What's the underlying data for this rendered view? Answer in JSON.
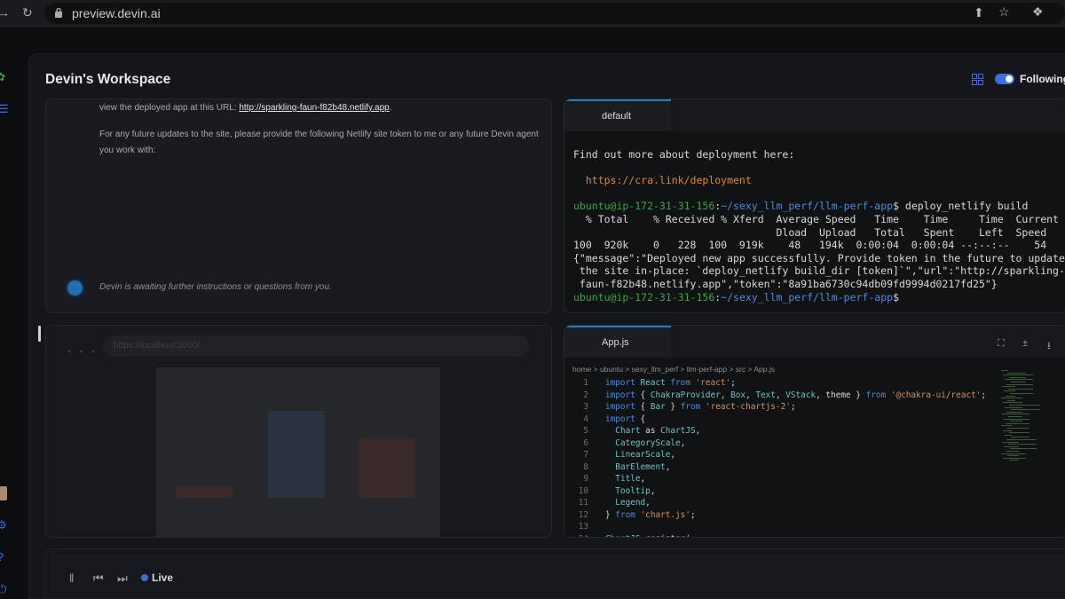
{
  "browser": {
    "url": "preview.devin.ai"
  },
  "workspace": {
    "title": "Devin's Workspace",
    "following_label": "Following"
  },
  "chat": {
    "line1_prefix": "view the deployed app at this URL: ",
    "line1_link": "http://sparkling-faun-f82b48.netlify.app",
    "line1_suffix": ".",
    "line2": "For any future updates to the site, please provide the following Netlify site token to me or any future Devin agent you work with:",
    "awaiting": "Devin is awaiting further instructions or questions from you."
  },
  "preview": {
    "url": "https://localhost:3000/"
  },
  "terminal": {
    "tab": "default",
    "lines": [
      {
        "type": "plain",
        "text": "Find out more about deployment here:"
      },
      {
        "type": "blank",
        "text": ""
      },
      {
        "type": "link",
        "text": "  https://cra.link/deployment"
      },
      {
        "type": "blank",
        "text": ""
      },
      {
        "type": "prompt",
        "user": "ubuntu@ip-172-31-31-156",
        "path": "~/sexy_llm_perf/llm-perf-app",
        "cmd": "$ deploy_netlify build"
      },
      {
        "type": "plain",
        "text": "  % Total    % Received % Xferd  Average Speed   Time    Time     Time  Current"
      },
      {
        "type": "plain",
        "text": "                                 Dload  Upload   Total   Spent    Left  Speed"
      },
      {
        "type": "plain",
        "text": "100  920k    0   228  100  919k    48   194k  0:00:04  0:00:04 --:--:--    54"
      },
      {
        "type": "plain",
        "text": "{\"message\":\"Deployed new app successfully. Provide token in the future to update"
      },
      {
        "type": "plain",
        "text": " the site in-place: `deploy_netlify build_dir [token]`\",\"url\":\"http://sparkling-"
      },
      {
        "type": "plain",
        "text": " faun-f82b48.netlify.app\",\"token\":\"8a91ba6730c94db09fd9994d0217fd25\"}"
      },
      {
        "type": "prompt",
        "user": "ubuntu@ip-172-31-31-156",
        "path": "~/sexy_llm_perf/llm-perf-app",
        "cmd": "$ "
      }
    ]
  },
  "editor": {
    "tab": "App.js",
    "breadcrumb": "home > ubuntu > sexy_llm_perf > llm-perf-app > src > App.js",
    "lines": [
      {
        "n": "1",
        "tokens": [
          [
            "kw",
            "import "
          ],
          [
            "id",
            "React "
          ],
          [
            "kw",
            "from "
          ],
          [
            "st",
            "'react'"
          ],
          [
            "pl",
            ";"
          ]
        ]
      },
      {
        "n": "2",
        "tokens": [
          [
            "kw",
            "import "
          ],
          [
            "pl",
            "{ "
          ],
          [
            "id",
            "ChakraProvider"
          ],
          [
            "pl",
            ", "
          ],
          [
            "id",
            "Box"
          ],
          [
            "pl",
            ", "
          ],
          [
            "id",
            "Text"
          ],
          [
            "pl",
            ", "
          ],
          [
            "id",
            "VStack"
          ],
          [
            "pl",
            ", theme } "
          ],
          [
            "kw",
            "from "
          ],
          [
            "st",
            "'@chakra-ui/react'"
          ],
          [
            "pl",
            ";"
          ]
        ]
      },
      {
        "n": "3",
        "tokens": [
          [
            "kw",
            "import "
          ],
          [
            "pl",
            "{ "
          ],
          [
            "id",
            "Bar "
          ],
          [
            "pl",
            "} "
          ],
          [
            "kw",
            "from "
          ],
          [
            "st",
            "'react-chartjs-2'"
          ],
          [
            "pl",
            ";"
          ]
        ]
      },
      {
        "n": "4",
        "tokens": [
          [
            "kw",
            "import "
          ],
          [
            "pl",
            "{"
          ]
        ]
      },
      {
        "n": "5",
        "tokens": [
          [
            "pl",
            "  "
          ],
          [
            "id",
            "Chart "
          ],
          [
            "pl",
            "as "
          ],
          [
            "id",
            "ChartJS"
          ],
          [
            "pl",
            ","
          ]
        ]
      },
      {
        "n": "6",
        "tokens": [
          [
            "pl",
            "  "
          ],
          [
            "id",
            "CategoryScale"
          ],
          [
            "pl",
            ","
          ]
        ]
      },
      {
        "n": "7",
        "tokens": [
          [
            "pl",
            "  "
          ],
          [
            "id",
            "LinearScale"
          ],
          [
            "pl",
            ","
          ]
        ]
      },
      {
        "n": "8",
        "tokens": [
          [
            "pl",
            "  "
          ],
          [
            "id",
            "BarElement"
          ],
          [
            "pl",
            ","
          ]
        ]
      },
      {
        "n": "9",
        "tokens": [
          [
            "pl",
            "  "
          ],
          [
            "id",
            "Title"
          ],
          [
            "pl",
            ","
          ]
        ]
      },
      {
        "n": "10",
        "tokens": [
          [
            "pl",
            "  "
          ],
          [
            "id",
            "Tooltip"
          ],
          [
            "pl",
            ","
          ]
        ]
      },
      {
        "n": "11",
        "tokens": [
          [
            "pl",
            "  "
          ],
          [
            "id",
            "Legend"
          ],
          [
            "pl",
            ","
          ]
        ]
      },
      {
        "n": "12",
        "tokens": [
          [
            "pl",
            "} "
          ],
          [
            "kw",
            "from "
          ],
          [
            "st",
            "'chart.js'"
          ],
          [
            "pl",
            ";"
          ]
        ]
      },
      {
        "n": "13",
        "tokens": []
      },
      {
        "n": "14",
        "tokens": [
          [
            "id",
            "ChartJS"
          ],
          [
            "pl",
            ".register("
          ]
        ]
      }
    ]
  },
  "playback": {
    "live_label": "Live"
  },
  "colors": {
    "accent": "#3f6fd6",
    "tab_highlight": "#1f7fc4",
    "prompt_green": "#3ba34a",
    "link_orange": "#d98a3a"
  }
}
